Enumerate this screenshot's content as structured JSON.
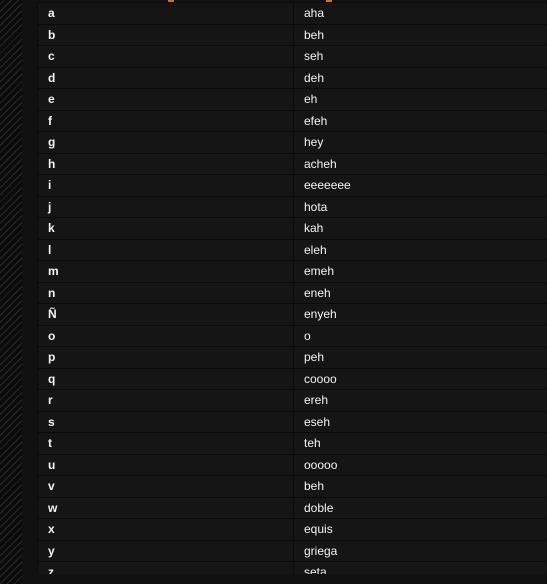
{
  "page": {
    "background_color": "#111111",
    "gutter": {
      "name": "hatched-margin",
      "stripe_color": "#2b2b2b",
      "base_color": "#0b0b0b"
    }
  },
  "header_sliver": {
    "visible_fragment": true,
    "accent_color": "#c8761f",
    "note": ""
  },
  "table": {
    "row_background": "#151515",
    "separator_color": "#0a0a0a",
    "text_color": "#f4f4f4",
    "columns": [
      {
        "key": "letter",
        "header": ""
      },
      {
        "key": "name",
        "header": ""
      }
    ],
    "rows": [
      {
        "letter": "a",
        "name": "aha"
      },
      {
        "letter": "b",
        "name": "beh"
      },
      {
        "letter": "c",
        "name": "seh"
      },
      {
        "letter": "d",
        "name": "deh"
      },
      {
        "letter": "e",
        "name": "eh"
      },
      {
        "letter": "f",
        "name": "efeh"
      },
      {
        "letter": "g",
        "name": "hey"
      },
      {
        "letter": "h",
        "name": "acheh"
      },
      {
        "letter": "i",
        "name": "eeeeeee"
      },
      {
        "letter": "j",
        "name": "hota"
      },
      {
        "letter": "k",
        "name": "kah"
      },
      {
        "letter": "l",
        "name": "eleh"
      },
      {
        "letter": "m",
        "name": "emeh"
      },
      {
        "letter": "n",
        "name": "eneh"
      },
      {
        "letter": "Ñ",
        "name": "enyeh"
      },
      {
        "letter": "o",
        "name": "o"
      },
      {
        "letter": "p",
        "name": "peh"
      },
      {
        "letter": "q",
        "name": "coooo"
      },
      {
        "letter": "r",
        "name": "ereh"
      },
      {
        "letter": "s",
        "name": "eseh"
      },
      {
        "letter": "t",
        "name": "teh"
      },
      {
        "letter": "u",
        "name": "ooooo"
      },
      {
        "letter": "v",
        "name": "beh"
      },
      {
        "letter": "w",
        "name": "doble"
      },
      {
        "letter": "x",
        "name": "equis"
      },
      {
        "letter": "y",
        "name": "griega"
      },
      {
        "letter": "z",
        "name": "seta"
      }
    ]
  }
}
